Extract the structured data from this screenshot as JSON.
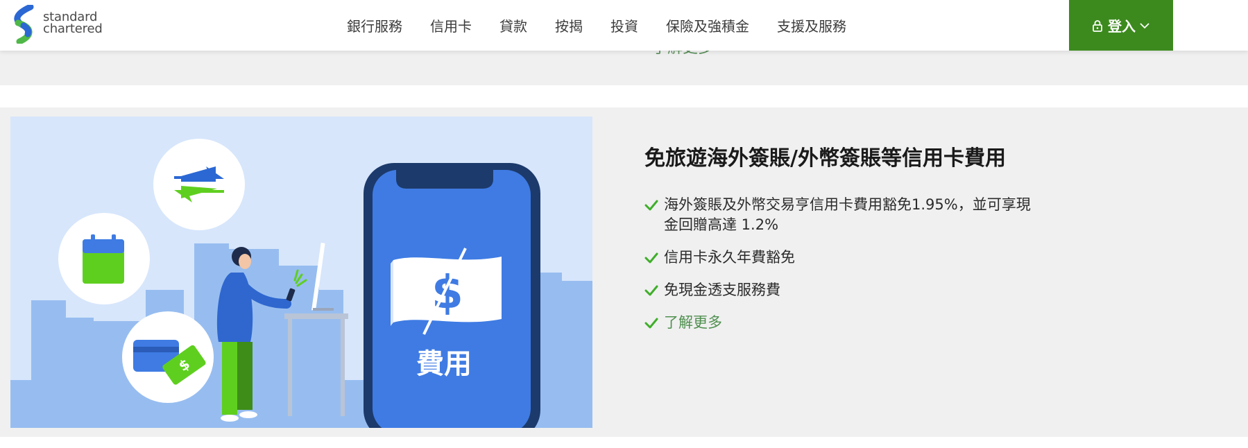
{
  "brand": {
    "line1": "standard",
    "line2": "chartered",
    "colors": {
      "blue": "#2b68d4",
      "green": "#4fb848"
    }
  },
  "nav": {
    "items": [
      "銀行服務",
      "信用卡",
      "貸款",
      "按揭",
      "投資",
      "保險及強積金",
      "支援及服務"
    ]
  },
  "login": {
    "label": "登入",
    "icon": "lock-icon",
    "color": "#3c8a1e"
  },
  "previous_section": {
    "link_label": "了解更多"
  },
  "feature": {
    "title": "免旅遊海外簽賬/外幣簽賬等信用卡費用",
    "bullets": [
      "海外簽賬及外幣交易亨信用卡費用豁免1.95%，並可享現金回贈高達 1.2%",
      "信用卡永久年費豁免",
      "免現金透支服務費"
    ],
    "link_label": "了解更多",
    "illustration": {
      "phone_label": "費用",
      "currency_symbol": "$",
      "icons": [
        "exchange-arrows-icon",
        "calendar-icon",
        "credit-card-icon",
        "cash-note-icon"
      ],
      "colors": {
        "sky": "#d7e6fb",
        "buildings": "#97bdf0",
        "phone": "#1c3a6b",
        "screen": "#3f7be3",
        "accent_green": "#5fcf1f"
      }
    }
  }
}
